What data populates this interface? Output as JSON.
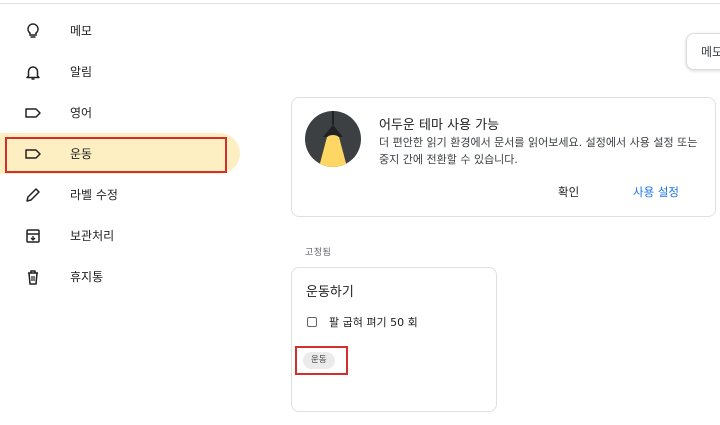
{
  "sidebar": {
    "items": [
      {
        "label": "메모",
        "icon": "lightbulb-icon",
        "active": false
      },
      {
        "label": "알림",
        "icon": "bell-icon",
        "active": false
      },
      {
        "label": "영어",
        "icon": "label-icon",
        "active": false
      },
      {
        "label": "운동",
        "icon": "label-icon",
        "active": true
      },
      {
        "label": "라벨 수정",
        "icon": "pencil-icon",
        "active": false
      },
      {
        "label": "보관처리",
        "icon": "archive-icon",
        "active": false
      },
      {
        "label": "휴지통",
        "icon": "trash-icon",
        "active": false
      }
    ]
  },
  "tooltip": {
    "label": "메모"
  },
  "banner": {
    "title": "어두운 테마 사용 가능",
    "text": "더 편안한 읽기 환경에서 문서를 읽어보세요. 설정에서 사용 설정 또는 중지 간에 전환할 수 있습니다.",
    "confirm_label": "확인",
    "enable_label": "사용 설정",
    "icon": "lamp-icon"
  },
  "pinned_label": "고정됨",
  "note": {
    "title": "운동하기",
    "checklist": [
      {
        "text": "팔 굽혀 펴기 50 회",
        "checked": false
      }
    ],
    "label_chip": "운동"
  },
  "colors": {
    "active_bg": "#feefc3",
    "accent": "#1a73e8",
    "highlight_box": "#d32f2f"
  }
}
